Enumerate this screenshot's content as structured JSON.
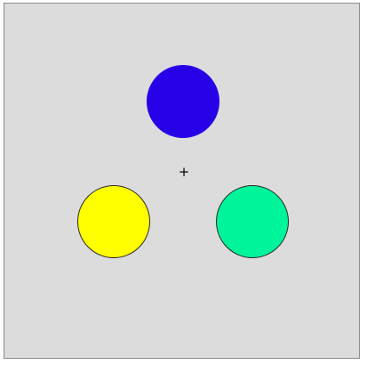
{
  "stimulus": {
    "background_color": "#dcdcdc",
    "fixation_symbol": "+",
    "circles": [
      {
        "name": "top",
        "color": "#2800e8",
        "outlined": false
      },
      {
        "name": "left",
        "color": "#ffff00",
        "outlined": true
      },
      {
        "name": "right",
        "color": "#00f59a",
        "outlined": true
      }
    ]
  }
}
